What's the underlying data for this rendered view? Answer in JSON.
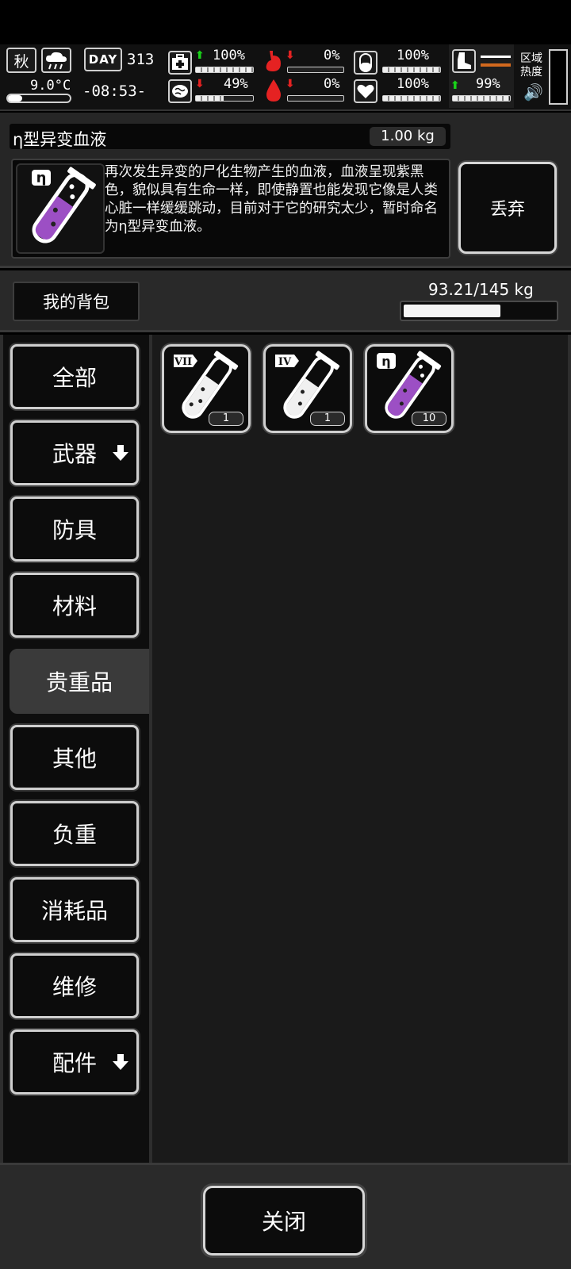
{
  "hud": {
    "season": "秋",
    "temperature": "9.0°C",
    "day_badge": "DAY",
    "day_number": "313",
    "clock": "-08:53-",
    "stats": {
      "health": {
        "value": "100%",
        "fraction": 1.0,
        "trend": "up"
      },
      "mood": {
        "value": "49%",
        "fraction": 0.49,
        "trend": "down"
      },
      "hunger": {
        "value": "0%",
        "fraction": 0.0,
        "trend": "down"
      },
      "thirst": {
        "value": "0%",
        "fraction": 0.0,
        "trend": "down"
      },
      "stomach": {
        "value": "100%",
        "fraction": 1.0
      },
      "heart": {
        "value": "100%",
        "fraction": 1.0
      },
      "stamina": {
        "value": "99%",
        "fraction": 0.99,
        "trend": "up"
      }
    },
    "zone_heat_label": "区域\n热度",
    "colors": {
      "up": "#19d219",
      "down": "#e52222",
      "orange": "#d2691e"
    }
  },
  "item": {
    "name": "η型异变血液",
    "weight": "1.00 kg",
    "description": "再次发生异变的尸化生物产生的血液，血液呈现紫黑色，貌似具有生命一样，即使静置也能发现它像是人类心脏一样缓缓跳动，目前对于它的研究太少，暂时命名为η型异变血液。",
    "discard_label": "丢弃",
    "icon_badge": "η",
    "liquid_color": "#9c4fc4"
  },
  "backpack": {
    "tab_label": "我的背包",
    "capacity_text": "93.21/145 kg",
    "capacity_fraction": 0.6428
  },
  "categories": [
    {
      "label": "全部"
    },
    {
      "label": "武器",
      "expand": true
    },
    {
      "label": "防具"
    },
    {
      "label": "材料"
    },
    {
      "label": "贵重品",
      "selected": true
    },
    {
      "label": "其他"
    },
    {
      "label": "负重"
    },
    {
      "label": "消耗品"
    },
    {
      "label": "维修"
    },
    {
      "label": "配件",
      "expand": true
    }
  ],
  "slots": [
    {
      "badge": "VII",
      "count": "1",
      "liquid": "#f0f0f0"
    },
    {
      "badge": "IV",
      "count": "1",
      "liquid": "#f0f0f0"
    },
    {
      "badge": "η",
      "count": "10",
      "liquid": "#9c4fc4",
      "selected": true
    }
  ],
  "close_label": "关闭"
}
